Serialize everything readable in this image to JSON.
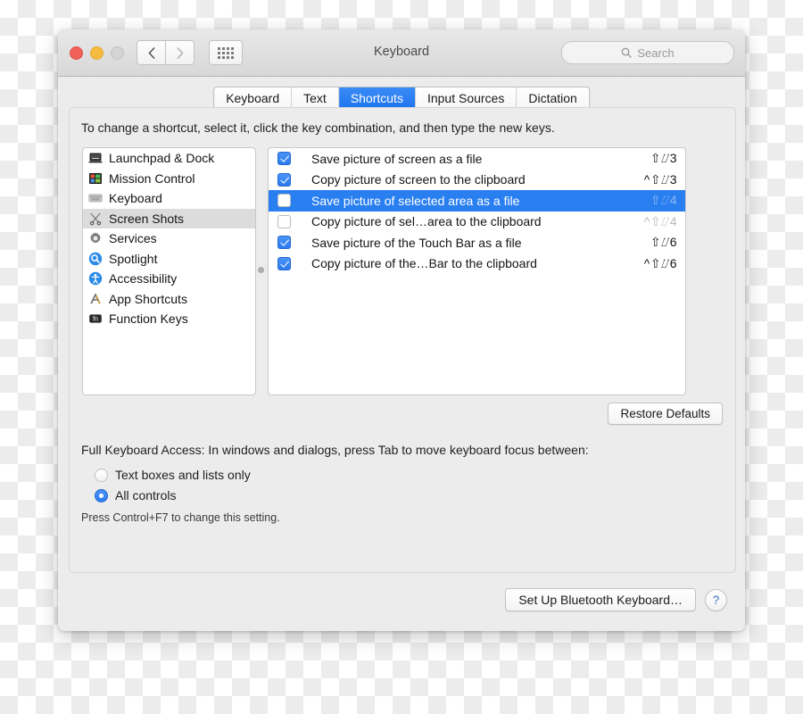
{
  "window": {
    "title": "Keyboard",
    "traffic_lights": [
      "close",
      "minimize",
      "zoom"
    ],
    "nav_back_icon": "chevron-left-icon",
    "nav_forward_icon": "chevron-right-icon",
    "grid_icon": "show-all-grid-icon",
    "search": {
      "placeholder": "Search",
      "icon": "search-icon"
    }
  },
  "tabs": [
    {
      "label": "Keyboard",
      "active": false
    },
    {
      "label": "Text",
      "active": false
    },
    {
      "label": "Shortcuts",
      "active": true
    },
    {
      "label": "Input Sources",
      "active": false
    },
    {
      "label": "Dictation",
      "active": false
    }
  ],
  "instruction": "To change a shortcut, select it, click the key combination, and then type the new keys.",
  "categories": [
    {
      "label": "Launchpad & Dock",
      "icon": "laptop-icon",
      "selected": false
    },
    {
      "label": "Mission Control",
      "icon": "mission-control-icon",
      "selected": false
    },
    {
      "label": "Keyboard",
      "icon": "keyboard-icon",
      "selected": false
    },
    {
      "label": "Screen Shots",
      "icon": "scissors-icon",
      "selected": true
    },
    {
      "label": "Services",
      "icon": "gear-icon",
      "selected": false
    },
    {
      "label": "Spotlight",
      "icon": "spotlight-icon",
      "selected": false
    },
    {
      "label": "Accessibility",
      "icon": "accessibility-icon",
      "selected": false
    },
    {
      "label": "App Shortcuts",
      "icon": "app-shortcuts-icon",
      "selected": false
    },
    {
      "label": "Function Keys",
      "icon": "fn-key-icon",
      "selected": false
    }
  ],
  "shortcuts": [
    {
      "label": "Save picture of screen as a file",
      "keys": "⇧⌰3",
      "checked": true,
      "selected": false
    },
    {
      "label": "Copy picture of screen to the clipboard",
      "keys": "^⇧⌰3",
      "checked": true,
      "selected": false
    },
    {
      "label": "Save picture of selected area as a file",
      "keys": "⇧⌰4",
      "checked": false,
      "selected": true
    },
    {
      "label": "Copy picture of sel…area to the clipboard",
      "keys": "^⇧⌰4",
      "checked": false,
      "selected": false
    },
    {
      "label": "Save picture of the Touch Bar as a file",
      "keys": "⇧⌰6",
      "checked": true,
      "selected": false
    },
    {
      "label": "Copy picture of the…Bar to the clipboard",
      "keys": "^⇧⌰6",
      "checked": true,
      "selected": false
    }
  ],
  "restore_defaults_label": "Restore Defaults",
  "full_keyboard_access": {
    "label": "Full Keyboard Access: In windows and dialogs, press Tab to move keyboard focus between:",
    "options": [
      {
        "label": "Text boxes and lists only",
        "selected": false
      },
      {
        "label": "All controls",
        "selected": true
      }
    ],
    "note": "Press Control+F7 to change this setting."
  },
  "footer": {
    "bluetooth_label": "Set Up Bluetooth Keyboard…",
    "help_label": "?"
  },
  "colors": {
    "accent_blue": "#2a7ff0",
    "tab_active_blue": "#2b7bf0",
    "window_bg": "#ececec",
    "panel_bg": "#ffffff",
    "row_selected_grey": "#dcdcdc"
  }
}
